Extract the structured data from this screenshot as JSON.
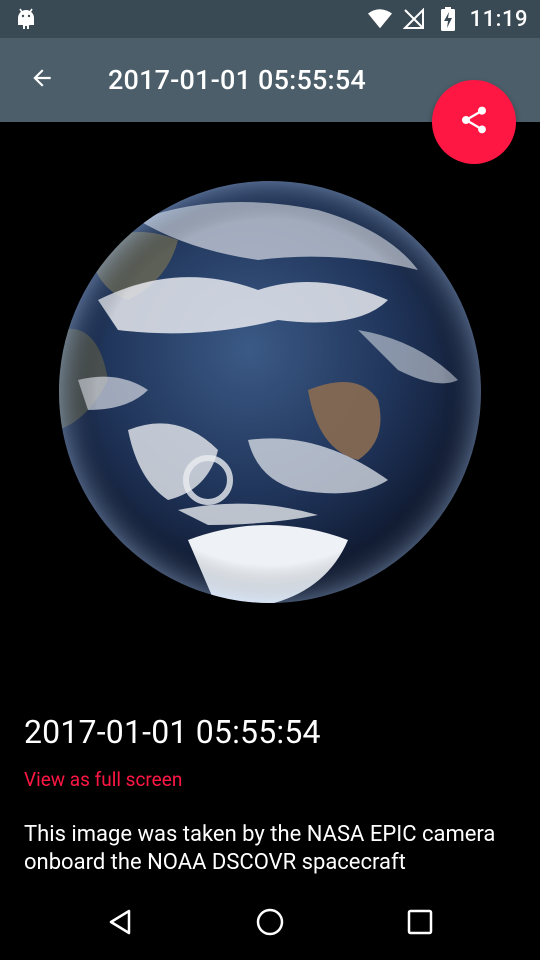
{
  "status_bar": {
    "time": "11:19",
    "icons": [
      "android-debug-icon",
      "wifi-icon",
      "no-signal-icon",
      "battery-charging-icon"
    ]
  },
  "app_bar": {
    "title": "2017-01-01 05:55:54",
    "back_icon": "arrow-back-icon"
  },
  "fab": {
    "icon": "share-icon",
    "color": "#ff1744"
  },
  "image": {
    "subject": "earth"
  },
  "caption": {
    "title": "2017-01-01 05:55:54",
    "link": "View as full screen",
    "description": "This image was taken by the NASA EPIC camera onboard the NOAA DSCOVR spacecraft"
  },
  "nav_bar": {
    "icons": [
      "back-triangle-icon",
      "home-circle-icon",
      "recents-square-icon"
    ]
  },
  "colors": {
    "status_bar": "#3a4a54",
    "app_bar": "#4b5e69",
    "accent": "#ff1744",
    "background": "#000000"
  }
}
